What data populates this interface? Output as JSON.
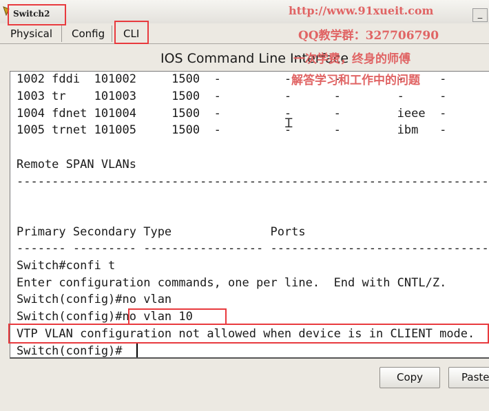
{
  "window": {
    "title": "Switch2",
    "minimize_glyph": "_"
  },
  "tabs": [
    {
      "label": "Physical"
    },
    {
      "label": "Config"
    },
    {
      "label": "CLI"
    }
  ],
  "cli": {
    "heading": "IOS Command Line Interface",
    "lines": [
      "1002 fddi  101002     1500  -         -      -        -     -",
      "1003 tr    101003     1500  -         -      -        -     -",
      "1004 fdnet 101004     1500  -         -      -        ieee  -",
      "1005 trnet 101005     1500  -         -      -        ibm   -",
      "",
      "Remote SPAN VLANs",
      "------------------------------------------------------------------------------",
      "",
      "",
      "Primary Secondary Type              Ports",
      "------- --------- ----------------- ------------------------------------------",
      "Switch#confi t",
      "Enter configuration commands, one per line.  End with CNTL/Z.",
      "Switch(config)#no vlan",
      "Switch(config)#no vlan 10",
      "VTP VLAN configuration not allowed when device is in CLIENT mode.",
      "Switch(config)#"
    ]
  },
  "buttons": {
    "copy": "Copy",
    "paste": "Paste"
  },
  "watermark": {
    "url": "http://www.91xueit.com",
    "qq": "QQ教学群：327706790",
    "teacher": "一次学费，终身的师傅",
    "answer": "解答学习和工作中的问题"
  },
  "colors": {
    "highlight": "#e8393d",
    "watermark": "#e06464",
    "terminal_bg": "#ffffff"
  }
}
